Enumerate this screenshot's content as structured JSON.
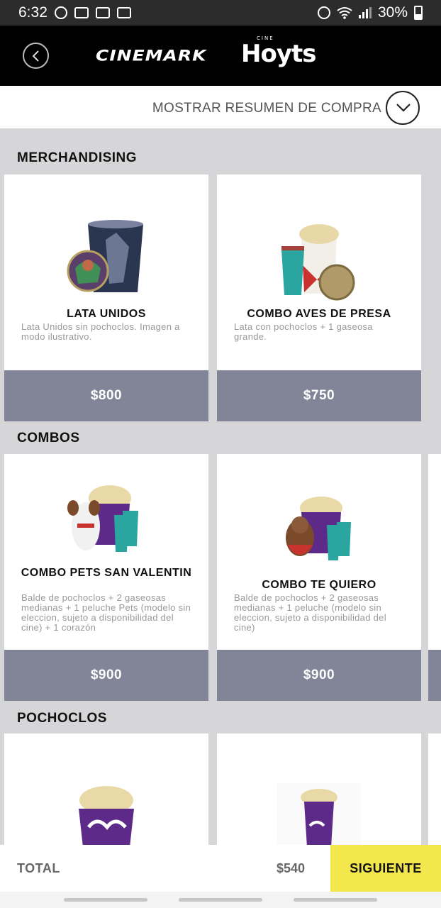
{
  "status_bar": {
    "time": "6:32",
    "battery": "30%"
  },
  "header": {
    "logo_left": "CINEMARK",
    "logo_right": "Hoyts",
    "logo_right_small": "CINE"
  },
  "summary": {
    "label": "MOSTRAR RESUMEN DE COMPRA"
  },
  "sections": [
    {
      "title": "MERCHANDISING",
      "items": [
        {
          "name": "LATA UNIDOS",
          "description": "Lata Unidos sin pochoclos. Imagen a modo ilustrativo.",
          "price": "$800"
        },
        {
          "name": "COMBO AVES DE PRESA",
          "description": "Lata con pochoclos + 1 gaseosa grande.",
          "price": "$750"
        }
      ]
    },
    {
      "title": "COMBOS",
      "items": [
        {
          "name": "COMBO PETS SAN VALENTIN",
          "description": "Balde de pochoclos + 2 gaseosas medianas + 1 peluche Pets (modelo sin eleccion, sujeto a disponibilidad del cine) + 1 corazón",
          "price": "$900"
        },
        {
          "name": "COMBO TE QUIERO",
          "description": "Balde de pochoclos + 2 gaseosas medianas + 1 peluche (modelo sin eleccion, sujeto a disponibilidad del cine)",
          "price": "$900"
        }
      ]
    },
    {
      "title": "POCHOCLOS",
      "items": [
        {
          "name": "",
          "description": "",
          "price": ""
        },
        {
          "name": "",
          "description": "",
          "price": ""
        }
      ]
    }
  ],
  "footer": {
    "total_label": "TOTAL",
    "total_value": "$540",
    "next_label": "SIGUIENTE"
  },
  "colors": {
    "accent": "#f2e84e",
    "price_bar": "#818597",
    "background": "#d6d6d8"
  }
}
